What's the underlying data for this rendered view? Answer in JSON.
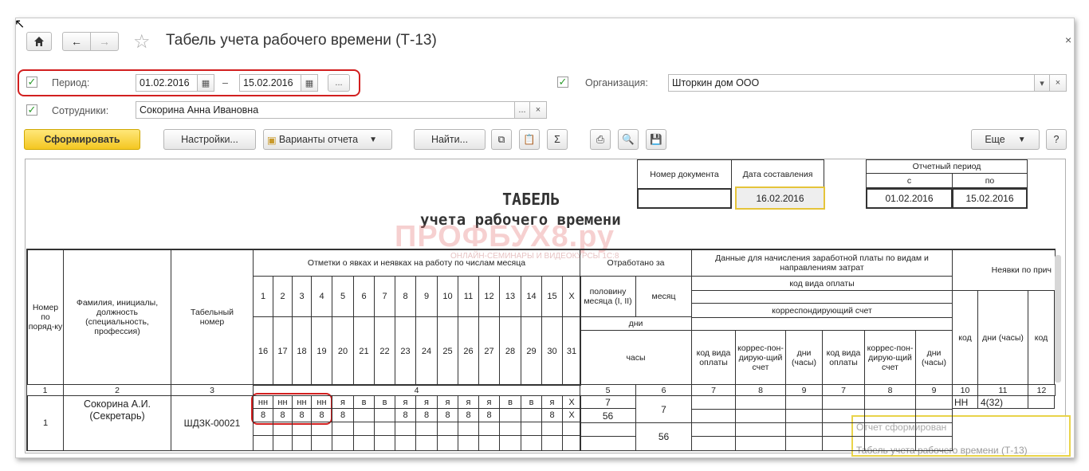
{
  "window": {
    "title": "Табель учета рабочего времени (Т-13)"
  },
  "filters": {
    "period_label": "Период:",
    "period_from": "01.02.2016",
    "period_dash": "–",
    "period_to": "15.02.2016",
    "period_more": "...",
    "org_label": "Организация:",
    "org_value": "Шторкин дом ООО",
    "employees_label": "Сотрудники:",
    "employees_value": "Сокорина Анна Ивановна",
    "ellipsis": "...",
    "clear": "×",
    "dropdown": "▾"
  },
  "toolbar": {
    "generate": "Сформировать",
    "settings": "Настройки...",
    "variants": "Варианты отчета",
    "find": "Найти...",
    "more": "Еще",
    "help": "?"
  },
  "report": {
    "doc_number_header": "Номер документа",
    "date_header": "Дата составления",
    "date_value": "16.02.2016",
    "period_header": "Отчетный период",
    "period_from_header": "с",
    "period_to_header": "по",
    "period_from": "01.02.2016",
    "period_to": "15.02.2016",
    "title_line1": "ТАБЕЛЬ",
    "title_line2": "учета  рабочего времени",
    "watermark": "ПРОФБУХ8.ру",
    "watermark_sub": "ОНЛАЙН-СЕМИНАРЫ И ВИДЕОКУРСЫ 1С:8",
    "col_num": "Номер по поряд-ку",
    "col_name": "Фамилия, инициалы, должность (специальность, профессия)",
    "col_tab": "Табельный номер",
    "col_marks": "Отметки о явках и неявках на работу по числам месяца",
    "col_worked": "Отработано за",
    "col_half": "половину месяца (I, II)",
    "col_month": "месяц",
    "col_days": "дни",
    "col_hours": "часы",
    "col_pay_data": "Данные для начисления заработной платы по видам и направлениям затрат",
    "col_pay_code": "код вида оплаты",
    "col_corr": "корреспондирующий счет",
    "sub_code": "код вида оплаты",
    "sub_corr": "коррес-пон-дирую-щий счет",
    "sub_days": "дни (часы)",
    "col_absence": "Неявки по прич",
    "abs_code": "код",
    "abs_days": "дни (часы)",
    "days_row1": [
      "1",
      "2",
      "3",
      "4",
      "5",
      "6",
      "7",
      "8",
      "9",
      "10",
      "11",
      "12",
      "13",
      "14",
      "15",
      "Х"
    ],
    "days_row2": [
      "16",
      "17",
      "18",
      "19",
      "20",
      "21",
      "22",
      "23",
      "24",
      "25",
      "26",
      "27",
      "28",
      "29",
      "30",
      "31"
    ],
    "colnums": [
      "1",
      "2",
      "3",
      "4",
      "5",
      "6",
      "7",
      "8",
      "9",
      "7",
      "8",
      "9",
      "10",
      "11",
      "12"
    ],
    "row": {
      "num": "1",
      "name": "Сокорина А.И.",
      "position": "(Секретарь)",
      "tab_number": "ШДЗК-00021",
      "codes": [
        "НН",
        "НН",
        "НН",
        "НН",
        "Я",
        "В",
        "В",
        "Я",
        "Я",
        "Я",
        "Я",
        "Я",
        "В",
        "В",
        "Я",
        "Х"
      ],
      "hours": [
        "8",
        "8",
        "8",
        "8",
        "8",
        "",
        "",
        "8",
        "8",
        "8",
        "8",
        "8",
        "",
        "",
        "8",
        "Х"
      ],
      "half_days": "7",
      "half_hours": "56",
      "month_days": "7",
      "month_hours": "56",
      "abs_code": "НН",
      "abs_days": "4(32)"
    },
    "tooltip1": "Отчет сформирован",
    "tooltip2": "Табель учета рабочего времени (Т-13)"
  }
}
